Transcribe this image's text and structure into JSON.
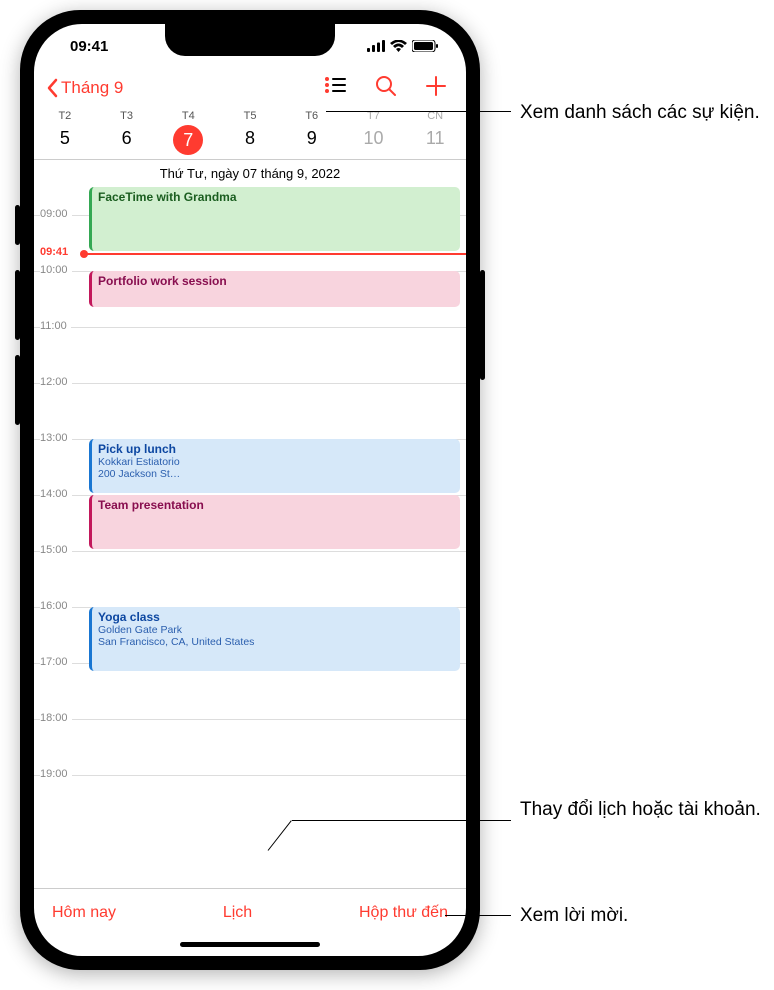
{
  "status": {
    "time": "09:41"
  },
  "nav": {
    "back": "Tháng 9"
  },
  "week": {
    "days": [
      {
        "dow": "T2",
        "num": "5"
      },
      {
        "dow": "T3",
        "num": "6"
      },
      {
        "dow": "T4",
        "num": "7",
        "selected": true
      },
      {
        "dow": "T5",
        "num": "8"
      },
      {
        "dow": "T6",
        "num": "9"
      },
      {
        "dow": "T7",
        "num": "10",
        "weekend": true
      },
      {
        "dow": "CN",
        "num": "11",
        "weekend": true
      }
    ],
    "date_title": "Thứ Tư, ngày 07 tháng 9, 2022"
  },
  "timeline": {
    "hours": [
      "09:00",
      "10:00",
      "11:00",
      "12:00",
      "13:00",
      "14:00",
      "15:00",
      "16:00",
      "17:00",
      "18:00",
      "19:00"
    ],
    "now": "09:41",
    "events": [
      {
        "title": "FaceTime with Grandma",
        "color": "green",
        "start": 8.5,
        "end": 9.67
      },
      {
        "title": "Portfolio work session",
        "color": "pink",
        "start": 10.0,
        "end": 10.67
      },
      {
        "title": "Pick up lunch",
        "sub1": "Kokkari Estiatorio",
        "sub2": "200 Jackson St…",
        "color": "blue",
        "start": 13.0,
        "end": 14.0
      },
      {
        "title": "Team presentation",
        "color": "pink",
        "start": 14.0,
        "end": 15.0
      },
      {
        "title": "Yoga class",
        "sub1": "Golden Gate Park",
        "sub2": "San Francisco, CA, United States",
        "color": "blue",
        "start": 16.0,
        "end": 17.17
      }
    ]
  },
  "toolbar": {
    "today": "Hôm nay",
    "calendars": "Lịch",
    "inbox": "Hộp thư đến"
  },
  "callouts": {
    "list": "Xem danh sách các sự kiện.",
    "cal": "Thay đổi lịch hoặc tài khoản.",
    "invite": "Xem lời mời."
  }
}
